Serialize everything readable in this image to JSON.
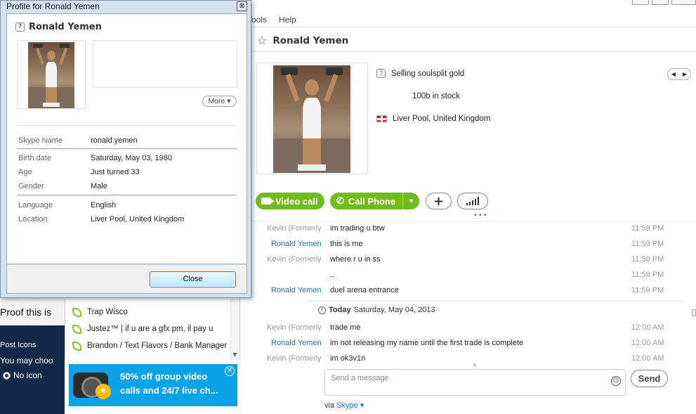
{
  "dialog": {
    "title": "Profile for Ronald Yemen",
    "close_x": "⊠",
    "name": "Ronald Yemen",
    "more_label": "More ▾",
    "fields": [
      {
        "key": "Skype Name",
        "value": "ronald.yemen"
      },
      {
        "key": "Birth date",
        "value": "Saturday, May 03, 1980"
      },
      {
        "key": "Age",
        "value": "Just turned 33"
      },
      {
        "key": "Gender",
        "value": "Male"
      },
      {
        "key": "Language",
        "value": "English"
      },
      {
        "key": "Location",
        "value": "Liver Pool, United Kingdom"
      }
    ],
    "close_button": "Close"
  },
  "left": {
    "proof_text": "Proof this is",
    "post_icons": "Post Icons",
    "you_may": "You may choo",
    "no_icon": "No icon"
  },
  "contacts": [
    {
      "name": "Trap Wisco"
    },
    {
      "name": "Justez™ | if u are a gfx pm, il pay u"
    },
    {
      "name": "Brandon / Text Flavors / Bank Manager"
    }
  ],
  "ad": {
    "line1": "50% off group video",
    "line2": "calls and 24/7 live ch...",
    "close": "✕"
  },
  "menu": {
    "tools": "Tools",
    "help": "Help"
  },
  "contact_header": {
    "name": "Ronald Yemen",
    "mood": "Selling soulsplit gold",
    "stock": "100b in stock",
    "location": "Liver Pool, United Kingdom"
  },
  "actions": {
    "video_call": "Video call",
    "call_phone": "Call Phone"
  },
  "messages": [
    {
      "who": "Kevin (Formerly",
      "me": false,
      "text": "im trading u btw",
      "time": "11:59 PM"
    },
    {
      "who": "Ronald Yemen",
      "me": true,
      "text": "this is me",
      "time": "11:59 PM"
    },
    {
      "who": "Kevin (Formerly",
      "me": false,
      "text": "where r u in ss",
      "time": "11:59 PM"
    },
    {
      "who": "",
      "me": false,
      "text": "..",
      "time": "11:59 PM"
    },
    {
      "who": "Ronald Yemen",
      "me": true,
      "text": "duel arena entrance",
      "time": "11:59 PM"
    }
  ],
  "today": {
    "label": "Today",
    "date": "Saturday, May 04, 2013"
  },
  "messages_today": [
    {
      "who": "Kevin (Formerly",
      "me": false,
      "text": "trade me",
      "time": "12:00 AM"
    },
    {
      "who": "Ronald Yemen",
      "me": true,
      "text": "im not releasing my name until the first trade is complete",
      "time": "12:00 AM"
    },
    {
      "who": "Kevin (Formerly",
      "me": false,
      "text": "im  ok3v1n",
      "time": "12:00 AM"
    }
  ],
  "composer": {
    "placeholder": "Send a message",
    "send": "Send",
    "via": "via",
    "service": "Skype ▾"
  }
}
